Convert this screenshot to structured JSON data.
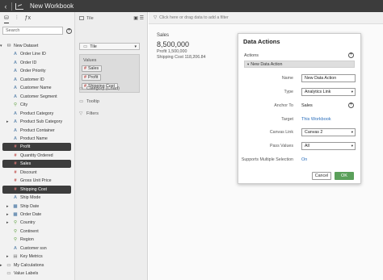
{
  "window": {
    "title": "New Workbook"
  },
  "left_panel": {
    "tabs": [
      {
        "icon": "data-icon"
      },
      {
        "icon": "visualizations-icon"
      },
      {
        "icon": "calculations-icon"
      }
    ],
    "search_placeholder": "Search",
    "tree": [
      {
        "label": "New Dataset",
        "icon": "database-icon",
        "glyph": "⛁",
        "kind": "fold",
        "expander": "▾",
        "level": 0
      },
      {
        "label": "Order Line ID",
        "icon": "attribute-icon",
        "glyph": "A",
        "kind": "attr",
        "level": 1
      },
      {
        "label": "Order ID",
        "icon": "attribute-icon",
        "glyph": "A",
        "kind": "attr",
        "level": 1
      },
      {
        "label": "Order Priority",
        "icon": "attribute-icon",
        "glyph": "A",
        "kind": "attr",
        "level": 1
      },
      {
        "label": "Customer ID",
        "icon": "attribute-icon",
        "glyph": "A",
        "kind": "attr",
        "level": 1
      },
      {
        "label": "Customer Name",
        "icon": "attribute-icon",
        "glyph": "A",
        "kind": "attr",
        "level": 1
      },
      {
        "label": "Customer Segment",
        "icon": "attribute-icon",
        "glyph": "A",
        "kind": "attr",
        "level": 1
      },
      {
        "label": "City",
        "icon": "location-icon",
        "glyph": "⚲",
        "kind": "geo",
        "level": 1
      },
      {
        "label": "Product Category",
        "icon": "attribute-icon",
        "glyph": "A",
        "kind": "attr",
        "level": 1
      },
      {
        "label": "Product Sub Category",
        "icon": "attribute-icon",
        "glyph": "A",
        "kind": "attr",
        "expander": "▸",
        "level": 1
      },
      {
        "label": "Product Container",
        "icon": "attribute-icon",
        "glyph": "A",
        "kind": "attr",
        "level": 1
      },
      {
        "label": "Product Name",
        "icon": "attribute-icon",
        "glyph": "A",
        "kind": "attr",
        "level": 1
      },
      {
        "label": "Profit",
        "icon": "measure-icon",
        "glyph": "#",
        "kind": "meas",
        "selected": true,
        "level": 1
      },
      {
        "label": "Quantity Ordered",
        "icon": "measure-icon",
        "glyph": "#",
        "kind": "meas",
        "level": 1
      },
      {
        "label": "Sales",
        "icon": "measure-icon",
        "glyph": "#",
        "kind": "meas",
        "selected": true,
        "level": 1
      },
      {
        "label": "Discount",
        "icon": "measure-icon",
        "glyph": "#",
        "kind": "meas",
        "level": 1
      },
      {
        "label": "Gross Unit Price",
        "icon": "measure-icon",
        "glyph": "#",
        "kind": "meas",
        "level": 1
      },
      {
        "label": "Shipping Cost",
        "icon": "measure-icon",
        "glyph": "#",
        "kind": "meas",
        "selected": true,
        "level": 1
      },
      {
        "label": "Ship Mode",
        "icon": "attribute-icon",
        "glyph": "A",
        "kind": "attr",
        "level": 1
      },
      {
        "label": "Ship Date",
        "icon": "date-icon",
        "glyph": "▦",
        "kind": "attr",
        "expander": "▸",
        "level": 1
      },
      {
        "label": "Order Date",
        "icon": "date-icon",
        "glyph": "▦",
        "kind": "attr",
        "expander": "▸",
        "level": 1
      },
      {
        "label": "Country",
        "icon": "location-icon",
        "glyph": "⚲",
        "kind": "geo",
        "expander": "▸",
        "level": 1
      },
      {
        "label": "Continent",
        "icon": "location-icon",
        "glyph": "⚲",
        "kind": "geo",
        "level": 1
      },
      {
        "label": "Region",
        "icon": "location-icon",
        "glyph": "⚲",
        "kind": "geo",
        "level": 1
      },
      {
        "label": "Customer ssn",
        "icon": "attribute-icon",
        "glyph": "A",
        "kind": "attr",
        "level": 1
      },
      {
        "label": "Key Metrics",
        "icon": "folder-icon",
        "glyph": "▤",
        "kind": "folder",
        "expander": "▸",
        "level": 1
      },
      {
        "label": "My Calculations",
        "icon": "folder-icon",
        "glyph": "▭",
        "kind": "folder",
        "expander": "▸",
        "level": 0
      },
      {
        "label": "Value Labels",
        "icon": "folder-icon",
        "glyph": "▭",
        "kind": "folder",
        "level": 0
      }
    ]
  },
  "grammar": {
    "header": "Tile",
    "tile_dropdown": "Tile",
    "values_label": "Values",
    "values": [
      "Sales",
      "Profit",
      "Shipping Cost"
    ],
    "sections": [
      "Category (Chart)",
      "Tooltip",
      "Filters"
    ]
  },
  "canvas": {
    "filter_hint": "Click here or drag data to add a filter",
    "tile_title": "Sales",
    "tile_value": "8,500,000",
    "tile_lines": [
      "Profit  1,500,000",
      "Shipping Cost  118,206.84"
    ]
  },
  "dialog": {
    "title": "Data Actions",
    "actions_label": "Actions",
    "action_item": "New Data Action",
    "fields": {
      "name_label": "Name",
      "name_value": "New Data Action",
      "type_label": "Type",
      "type_value": "Analytics Link",
      "anchor_label": "Anchor To",
      "anchor_value": "Sales",
      "target_label": "Target",
      "target_value": "This Workbook",
      "canvas_label": "Canvas Link",
      "canvas_value": "Canvas 2",
      "pass_label": "Pass Values",
      "pass_value": "All",
      "multi_label": "Supports Multiple Selection",
      "multi_value": "On"
    },
    "cancel_label": "Cancel",
    "ok_label": "OK"
  },
  "colors": {
    "titlebar": "#3c3c3c",
    "selected_row": "#3d3d3d",
    "measure": "#c0504d",
    "link": "#2a6ebb",
    "ok_button": "#5aa05a"
  }
}
